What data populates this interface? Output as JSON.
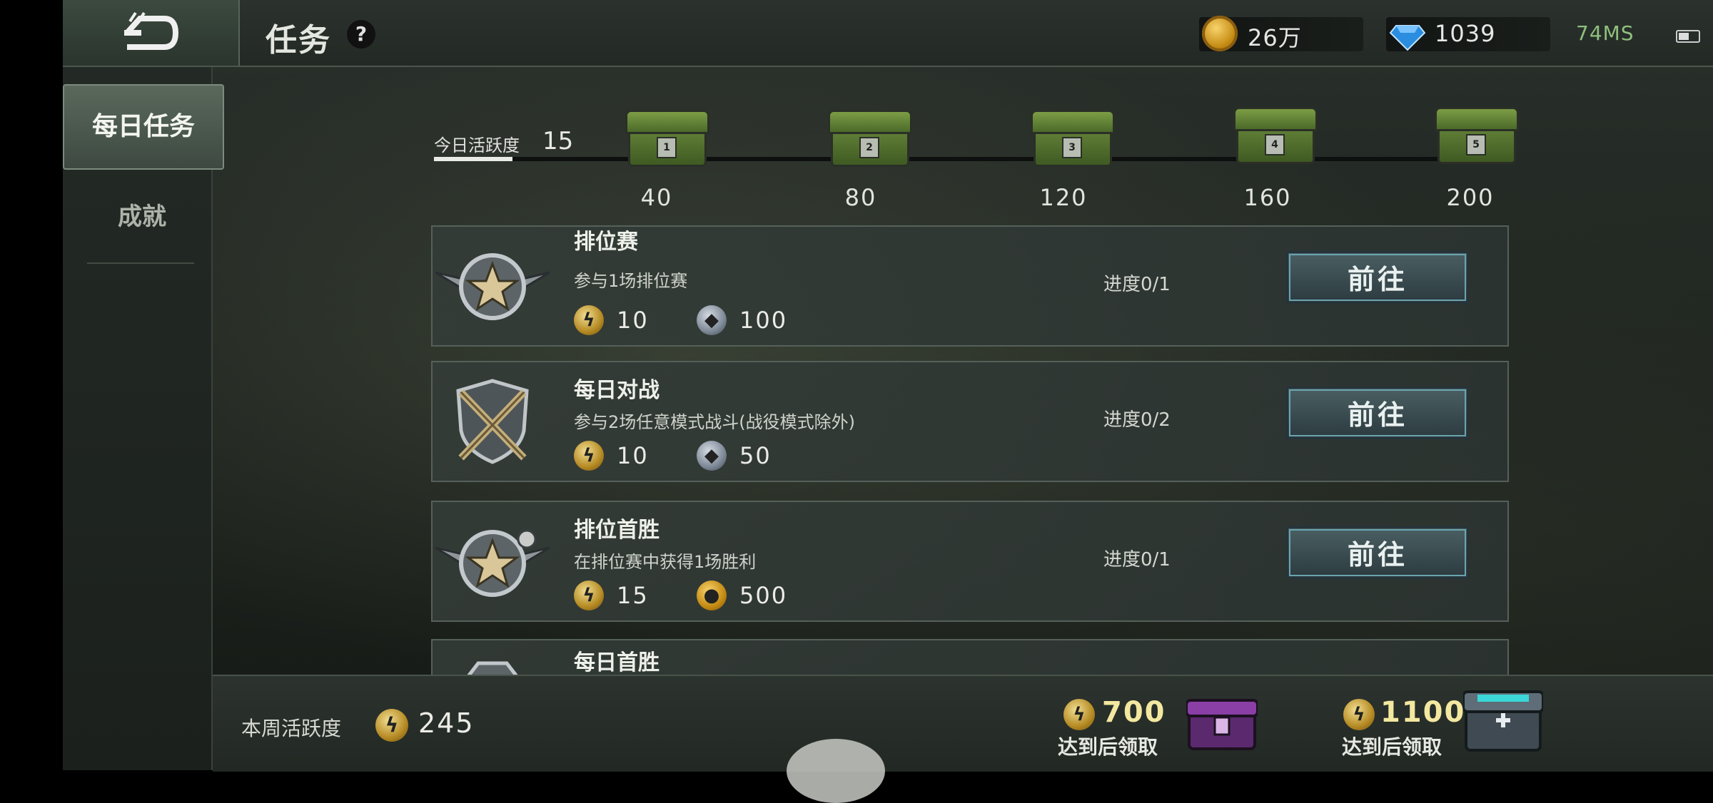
{
  "header": {
    "title": "任务",
    "help": "?",
    "coins": "26万",
    "diamonds": "1039",
    "ping": "74MS"
  },
  "sidebar": {
    "items": [
      {
        "label": "每日任务"
      },
      {
        "label": "成就"
      }
    ]
  },
  "activity": {
    "label": "今日活跃度",
    "value": "15",
    "progress_fraction": 0.075,
    "milestones": [
      {
        "box": "1",
        "value": "40"
      },
      {
        "box": "2",
        "value": "80"
      },
      {
        "box": "3",
        "value": "120"
      },
      {
        "box": "4",
        "value": "160"
      },
      {
        "box": "5",
        "value": "200"
      }
    ]
  },
  "tasks": [
    {
      "title": "排位赛",
      "desc": "参与1场排位赛",
      "reward1": "10",
      "reward2": "100",
      "reward2_type": "gear",
      "progress": "进度0/1",
      "button": "前往"
    },
    {
      "title": "每日对战",
      "desc": "参与2场任意模式战斗(战役模式除外)",
      "reward1": "10",
      "reward2": "50",
      "reward2_type": "gear",
      "progress": "进度0/2",
      "button": "前往"
    },
    {
      "title": "排位首胜",
      "desc": "在排位赛中获得1场胜利",
      "reward1": "15",
      "reward2": "500",
      "reward2_type": "coin",
      "progress": "进度0/1",
      "button": "前往"
    },
    {
      "title": "每日首胜"
    }
  ],
  "weekly": {
    "label": "本周活跃度",
    "value": "245",
    "goals": [
      {
        "value": "700",
        "text": "达到后领取"
      },
      {
        "value": "1100",
        "text": "达到后领取"
      }
    ]
  },
  "colors": {
    "accent_button_outline": "#6aa4ae",
    "gold": "#c48a12",
    "diamond": "#2a8de0"
  }
}
